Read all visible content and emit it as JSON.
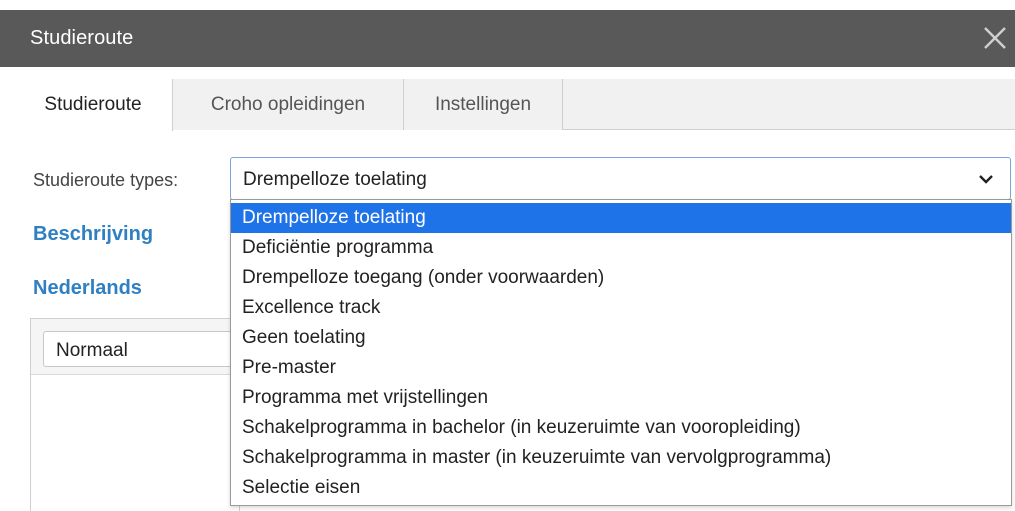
{
  "dialog": {
    "title": "Studieroute",
    "close_icon": "close-icon"
  },
  "tabs": [
    {
      "label": "Studieroute",
      "active": true
    },
    {
      "label": "Croho opleidingen",
      "active": false
    },
    {
      "label": "Instellingen",
      "active": false
    }
  ],
  "form": {
    "type_label": "Studieroute types:",
    "type_value": "Drempelloze toelating",
    "chevron_icon": "chevron-down-icon"
  },
  "sections": {
    "beschrijving": "Beschrijving",
    "nederlands": "Nederlands"
  },
  "editor": {
    "format_value": "Normaal"
  },
  "dropdown": {
    "options": [
      "Drempelloze toelating",
      "Deficiëntie programma",
      "Drempelloze toegang (onder voorwaarden)",
      "Excellence track",
      "Geen toelating",
      "Pre-master",
      "Programma met vrijstellingen",
      "Schakelprogramma in bachelor (in keuzeruimte van vooropleiding)",
      "Schakelprogramma in master (in keuzeruimte van vervolgprogramma)",
      "Selectie eisen"
    ],
    "selected_index": 0
  },
  "colors": {
    "titlebar": "#595959",
    "accent": "#2f80c2",
    "selection": "#1e73e8"
  }
}
